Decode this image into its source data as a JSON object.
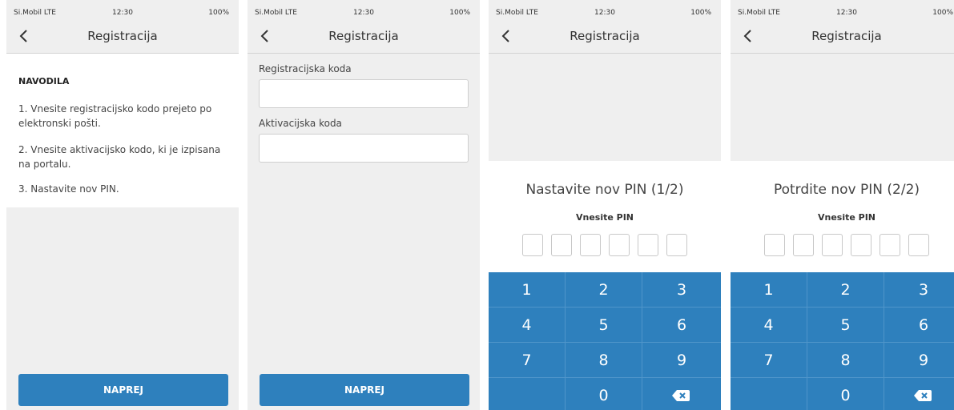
{
  "status": {
    "carrier": "Si.Mobil LTE",
    "time": "12:30",
    "battery": "100%"
  },
  "nav": {
    "title": "Registracija",
    "back_icon": "chevron-left-icon"
  },
  "screen1": {
    "heading": "NAVODILA",
    "steps": [
      "1. Vnesite registracijsko kodo prejeto po elektronski pošti.",
      "2. Vnesite aktivacijsko kodo, ki je izpisana na portalu.",
      "3. Nastavite nov PIN."
    ],
    "next_label": "NAPREJ"
  },
  "screen2": {
    "reg_label": "Registracijska koda",
    "reg_value": "",
    "act_label": "Aktivacijska koda",
    "act_value": "",
    "next_label": "NAPREJ"
  },
  "screen3": {
    "title": "Nastavite nov PIN (1/2)",
    "prompt": "Vnesite PIN",
    "pin_length": 6
  },
  "screen4": {
    "title": "Potrdite nov PIN (2/2)",
    "prompt": "Vnesite PIN",
    "pin_length": 6
  },
  "keypad": {
    "keys": [
      "1",
      "2",
      "3",
      "4",
      "5",
      "6",
      "7",
      "8",
      "9",
      "",
      "0"
    ],
    "delete_icon": "backspace-icon"
  },
  "colors": {
    "accent": "#2e80bd",
    "background": "#efefef",
    "panel": "#ffffff"
  }
}
